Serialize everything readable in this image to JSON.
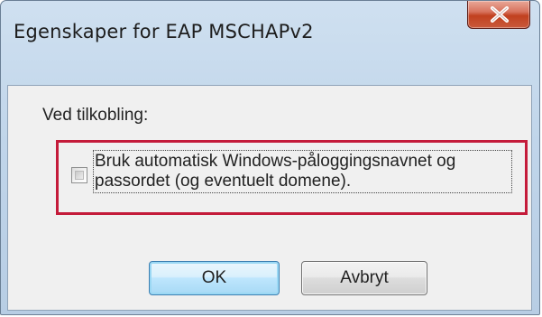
{
  "dialog": {
    "title": "Egenskaper for EAP MSCHAPv2",
    "close_icon": "close-x-icon",
    "connect_label": "Ved tilkobling:",
    "checkbox": {
      "label": "Bruk automatisk Windows-påloggingsnavnet og passordet (og eventuelt domene).",
      "checked": false
    },
    "highlight_color": "#c41b3a",
    "buttons": {
      "ok_label": "OK",
      "cancel_label": "Avbryt"
    }
  }
}
